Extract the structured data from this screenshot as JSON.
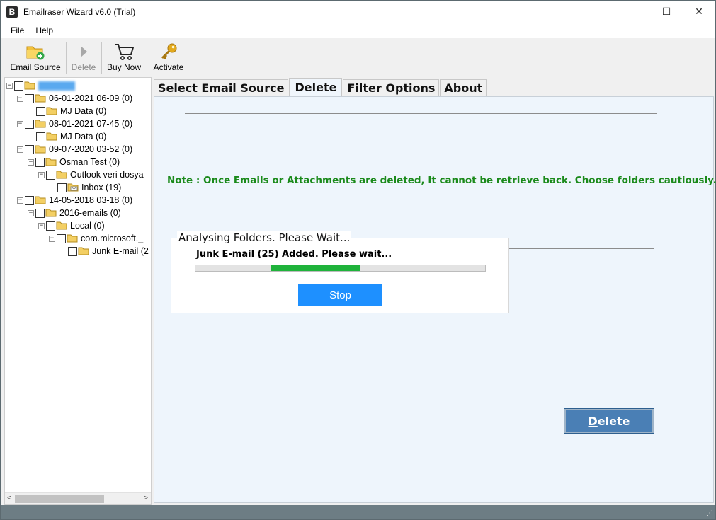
{
  "window": {
    "title": "Emailraser Wizard v6.0 (Trial)",
    "icon_letter": "B"
  },
  "window_controls": {
    "minimize": "—",
    "maximize": "☐",
    "close": "✕"
  },
  "menu": [
    "File",
    "Help"
  ],
  "toolbar": {
    "email_source": "Email Source",
    "delete": "Delete",
    "buy_now": "Buy Now",
    "activate": "Activate"
  },
  "tree": {
    "nodes": [
      {
        "label": "06-01-2021 06-09 (0)"
      },
      {
        "label": "MJ Data (0)"
      },
      {
        "label": "08-01-2021 07-45 (0)"
      },
      {
        "label": "MJ Data (0)"
      },
      {
        "label": "09-07-2020 03-52 (0)"
      },
      {
        "label": "Osman Test (0)"
      },
      {
        "label": "Outlook veri dosya"
      },
      {
        "label": "Inbox (19)"
      },
      {
        "label": "14-05-2018 03-18  (0)"
      },
      {
        "label": "2016-emails  (0)"
      },
      {
        "label": "Local  (0)"
      },
      {
        "label": "com.microsoft._"
      },
      {
        "label": "Junk E-mail (2"
      }
    ],
    "scroll_left": "<",
    "scroll_right": ">"
  },
  "tabs": [
    "Select Email Source",
    "Delete",
    "Filter Options",
    "About"
  ],
  "active_tab": "Delete",
  "note": "Note : Once Emails or Attachments are deleted, It cannot be retrieve back. Choose folders cautiously.",
  "progress_dialog": {
    "title": "Analysing Folders. Please Wait...",
    "status": "Junk E-mail (25) Added. Please wait...",
    "progress_start": 0.26,
    "progress_end": 0.57,
    "stop_label": "Stop"
  },
  "delete_button": {
    "accel": "D",
    "rest": "elete"
  },
  "colors": {
    "note_green": "#1b8a1b",
    "stop_blue": "#1e90ff",
    "delete_blue": "#4a7fb5",
    "progress_green": "#1fb33b"
  }
}
